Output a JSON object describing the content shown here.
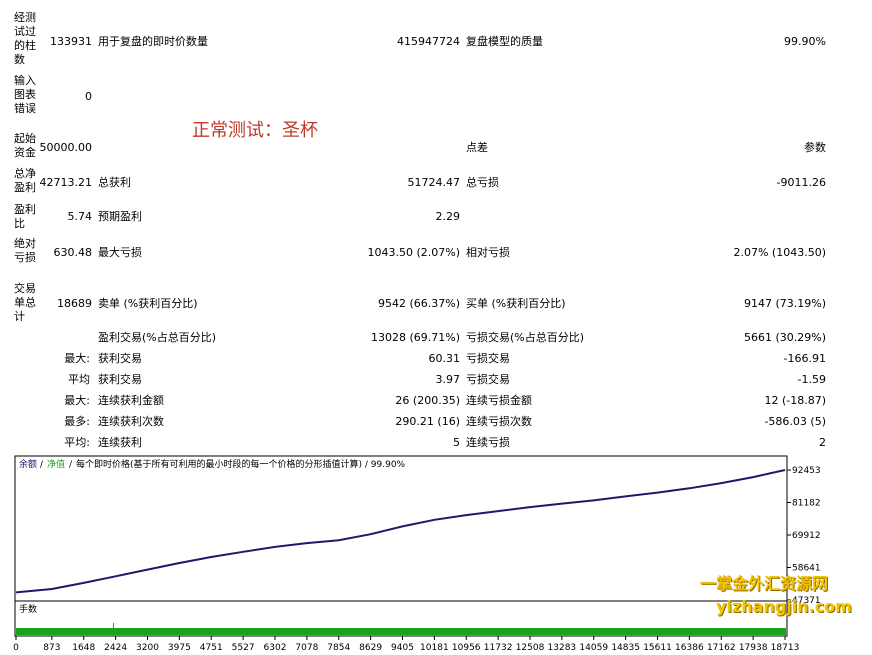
{
  "report": {
    "bars": {
      "label": "经测试过的柱数",
      "value": "133931",
      "ticks_label": "用于复盘的即时价数量",
      "ticks_value": "415947724",
      "quality_label": "复盘模型的质量",
      "quality_value": "99.90%"
    },
    "errors": {
      "label": "输入图表错误",
      "value": "0"
    },
    "deposit": {
      "label": "起始资金",
      "value": "50000.00",
      "spread_label": "点差",
      "spread_value": "参数"
    },
    "net": {
      "label": "总净盈利",
      "value": "42713.21",
      "gross_profit_label": "总获利",
      "gross_profit_value": "51724.47",
      "gross_loss_label": "总亏损",
      "gross_loss_value": "-9011.26"
    },
    "pf": {
      "label": "盈利比",
      "value": "5.74",
      "expected_label": "预期盈利",
      "expected_value": "2.29"
    },
    "dd": {
      "label": "绝对亏损",
      "value": "630.48",
      "max_label": "最大亏损",
      "max_value": "1043.50 (2.07%)",
      "rel_label": "相对亏损",
      "rel_value": "2.07% (1043.50)"
    },
    "trades": {
      "label": "交易单总计",
      "value": "18689",
      "short_label": "卖单 (%获利百分比)",
      "short_value": "9542 (66.37%)",
      "long_label": "买单 (%获利百分比)",
      "long_value": "9147 (73.19%)"
    },
    "winloss": {
      "win_label": "盈利交易(%占总百分比)",
      "win_value": "13028 (69.71%)",
      "loss_label": "亏损交易(%占总百分比)",
      "loss_value": "5661 (30.29%)"
    },
    "largest": {
      "prefix": "最大:",
      "win_label": "获利交易",
      "win_value": "60.31",
      "loss_label": "亏损交易",
      "loss_value": "-166.91"
    },
    "average": {
      "prefix": "平均",
      "win_label": "获利交易",
      "win_value": "3.97",
      "loss_label": "亏损交易",
      "loss_value": "-1.59"
    },
    "max_cons": {
      "prefix": "最大:",
      "win_label": "连续获利金额",
      "win_value": "26 (200.35)",
      "loss_label": "连续亏损金额",
      "loss_value": "12 (-18.87)"
    },
    "maximal": {
      "prefix": "最多:",
      "win_label": "连续获利次数",
      "win_value": "290.21 (16)",
      "loss_label": "连续亏损次数",
      "loss_value": "-586.03 (5)"
    },
    "avg_cons": {
      "prefix": "平均:",
      "win_label": "连续获利",
      "win_value": "5",
      "loss_label": "连续亏损",
      "loss_value": "2"
    }
  },
  "watermark": "正常测试：圣杯",
  "chart_header": {
    "balance": "余额",
    "equity": "净值",
    "rest": "每个即时价格(基于所有可利用的最小时段的每一个价格的分形插值计算) / 99.90%"
  },
  "lots_label": "手数",
  "site": {
    "line1": "一掌金外汇资源网",
    "line2": "yizhangjin.com"
  },
  "colors": {
    "balance_line": "#1a1a6e",
    "lots_bar": "#1aa31a",
    "grid": "#c8c8c8"
  },
  "chart_data": {
    "type": "line",
    "series": [
      {
        "name": "余额",
        "x": [
          0,
          873,
          1648,
          2424,
          3200,
          3975,
          4751,
          5527,
          6302,
          7078,
          7854,
          8629,
          9405,
          10181,
          10956,
          11732,
          12508,
          13283,
          14059,
          14835,
          15611,
          16386,
          17162,
          17938,
          18713
        ],
        "values": [
          50000,
          51200,
          53300,
          55600,
          57900,
          60200,
          62300,
          64100,
          65800,
          67100,
          68100,
          70200,
          72900,
          75200,
          76800,
          78200,
          79600,
          80800,
          81900,
          83300,
          84600,
          86100,
          87900,
          90000,
          92453
        ]
      }
    ],
    "x_ticks": [
      "0",
      "873",
      "1648",
      "2424",
      "3200",
      "3975",
      "4751",
      "5527",
      "6302",
      "7078",
      "7854",
      "8629",
      "9405",
      "10181",
      "10956",
      "11732",
      "12508",
      "13283",
      "14059",
      "14835",
      "15611",
      "16386",
      "17162",
      "17938",
      "18713"
    ],
    "y_ticks": [
      "92453",
      "81182",
      "69912",
      "58641",
      "47371"
    ],
    "ylim": [
      47371,
      92453
    ]
  }
}
